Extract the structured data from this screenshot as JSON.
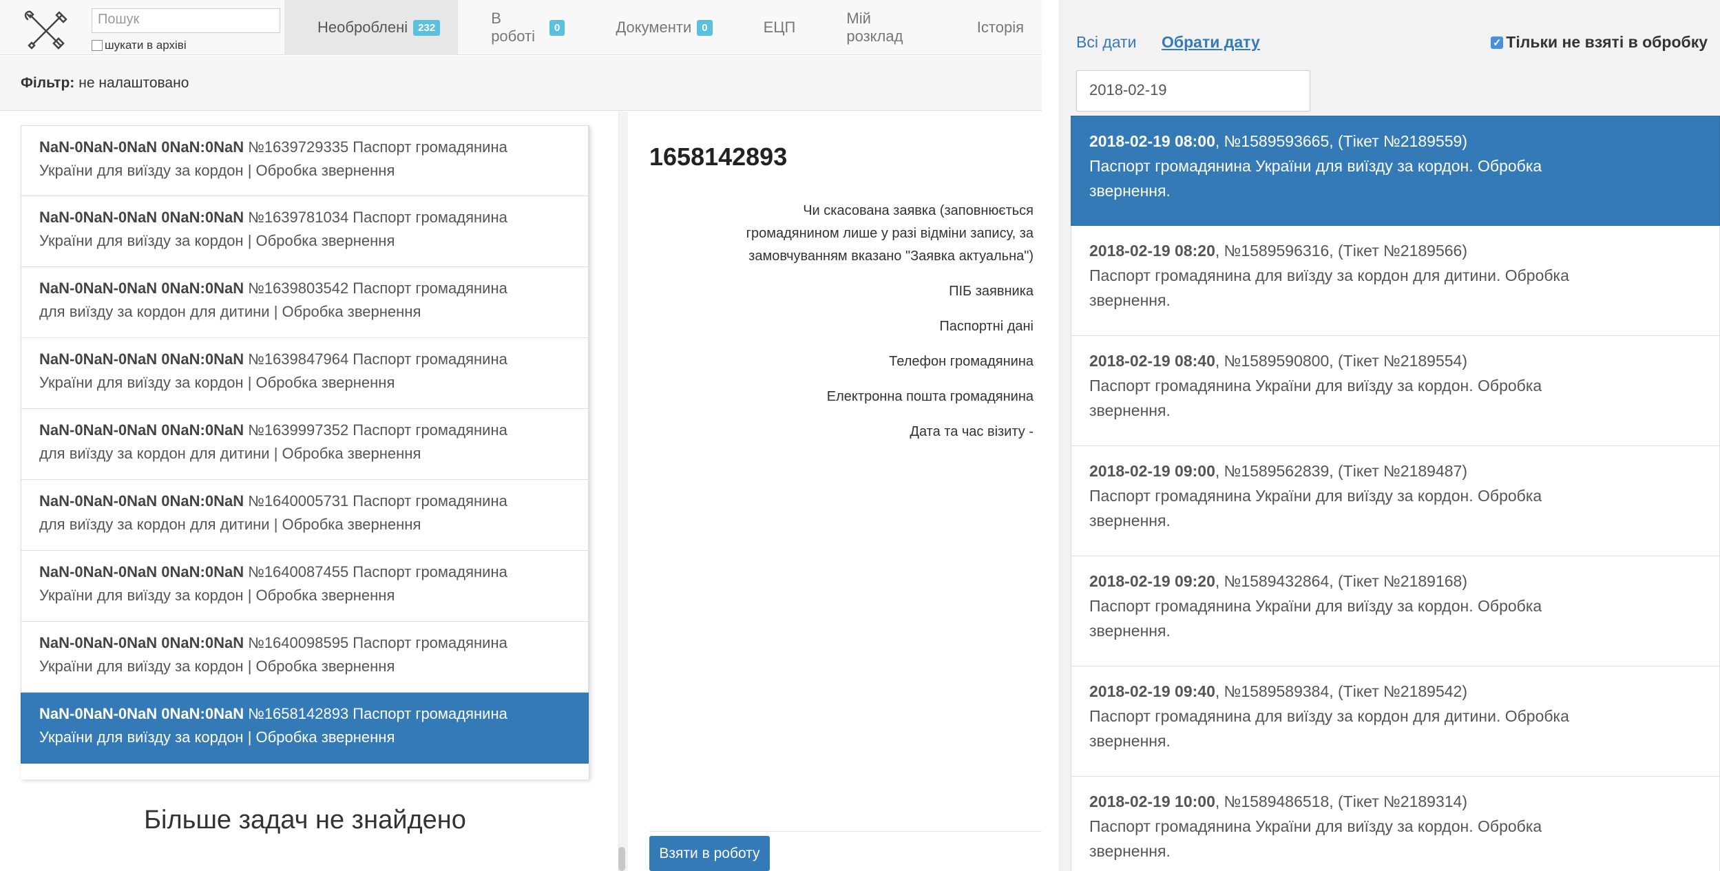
{
  "left": {
    "search": {
      "placeholder": "Пошук",
      "archive_label": "шукати в архіві"
    },
    "tabs": [
      {
        "label": "Необроблені",
        "badge": "232",
        "active": true
      },
      {
        "label": "В роботі",
        "badge": "0"
      },
      {
        "label": "Документи",
        "badge": "0"
      },
      {
        "label": "ЕЦП"
      },
      {
        "label": "Мій розклад"
      },
      {
        "label": "Історія"
      }
    ],
    "filter": {
      "label": "Фільтр:",
      "value": "не налаштовано"
    },
    "tasks": [
      {
        "date": "NaN-0NaN-0NaN 0NaN:0NaN",
        "text": "№1639729335 Паспорт громадянина",
        "line2": "України для виїзду за кордон | Обробка звернення"
      },
      {
        "date": "NaN-0NaN-0NaN 0NaN:0NaN",
        "text": "№1639781034 Паспорт громадянина",
        "line2": "України для виїзду за кордон | Обробка звернення"
      },
      {
        "date": "NaN-0NaN-0NaN 0NaN:0NaN",
        "text": "№1639803542 Паспорт громадянина",
        "line2": "для виїзду за кордон для дитини | Обробка звернення"
      },
      {
        "date": "NaN-0NaN-0NaN 0NaN:0NaN",
        "text": "№1639847964 Паспорт громадянина",
        "line2": "України для виїзду за кордон | Обробка звернення"
      },
      {
        "date": "NaN-0NaN-0NaN 0NaN:0NaN",
        "text": "№1639997352 Паспорт громадянина",
        "line2": "для виїзду за кордон для дитини | Обробка звернення"
      },
      {
        "date": "NaN-0NaN-0NaN 0NaN:0NaN",
        "text": "№1640005731 Паспорт громадянина",
        "line2": "для виїзду за кордон для дитини | Обробка звернення"
      },
      {
        "date": "NaN-0NaN-0NaN 0NaN:0NaN",
        "text": "№1640087455 Паспорт громадянина",
        "line2": "України для виїзду за кордон | Обробка звернення"
      },
      {
        "date": "NaN-0NaN-0NaN 0NaN:0NaN",
        "text": "№1640098595 Паспорт громадянина",
        "line2": "України для виїзду за кордон | Обробка звернення"
      },
      {
        "date": "NaN-0NaN-0NaN 0NaN:0NaN",
        "text": "№1658142893 Паспорт громадянина",
        "line2": "України для виїзду за кордон | Обробка звернення",
        "selected": true
      }
    ],
    "no_more_text": "Більше задач не знайдено",
    "detail": {
      "title": "1658142893",
      "fields": [
        "Чи скасована заявка (заповнюється",
        "громадянином лише у разі відміни запису, за",
        "замовчуванням вказано \"Заявка актуальна\")",
        "ПІБ заявника",
        "Паспортні дані",
        "Телефон громадянина",
        "Електронна пошта громадянина",
        "Дата та час візиту -"
      ],
      "take_button": "Взяти в роботу"
    }
  },
  "right": {
    "all_dates": "Всі дати",
    "pick_date": "Обрати дату",
    "only_not_taken": "Тільки не взяті в обробку",
    "only_not_taken_checked": true,
    "date_value": "2018-02-19",
    "slots": [
      {
        "time": "2018-02-19 08:00",
        "num": ", №1589593665, (Тікет №2189559)",
        "desc": "Паспорт громадянина України для виїзду за кордон. Обробка",
        "desc2": "звернення.",
        "selected": true
      },
      {
        "time": "2018-02-19 08:20",
        "num": ", №1589596316, (Тікет №2189566)",
        "desc": "Паспорт громадянина для виїзду за кордон для дитини. Обробка",
        "desc2": "звернення."
      },
      {
        "time": "2018-02-19 08:40",
        "num": ", №1589590800, (Тікет №2189554)",
        "desc": "Паспорт громадянина України для виїзду за кордон. Обробка",
        "desc2": "звернення."
      },
      {
        "time": "2018-02-19 09:00",
        "num": ", №1589562839, (Тікет №2189487)",
        "desc": "Паспорт громадянина України для виїзду за кордон. Обробка",
        "desc2": "звернення."
      },
      {
        "time": "2018-02-19 09:20",
        "num": ", №1589432864, (Тікет №2189168)",
        "desc": "Паспорт громадянина України для виїзду за кордон. Обробка",
        "desc2": "звернення."
      },
      {
        "time": "2018-02-19 09:40",
        "num": ", №1589589384, (Тікет №2189542)",
        "desc": "Паспорт громадянина для виїзду за кордон для дитини. Обробка",
        "desc2": "звернення."
      },
      {
        "time": "2018-02-19 10:00",
        "num": ", №1589486518, (Тікет №2189314)",
        "desc": "Паспорт громадянина України для виїзду за кордон. Обробка",
        "desc2": "звернення."
      }
    ]
  }
}
